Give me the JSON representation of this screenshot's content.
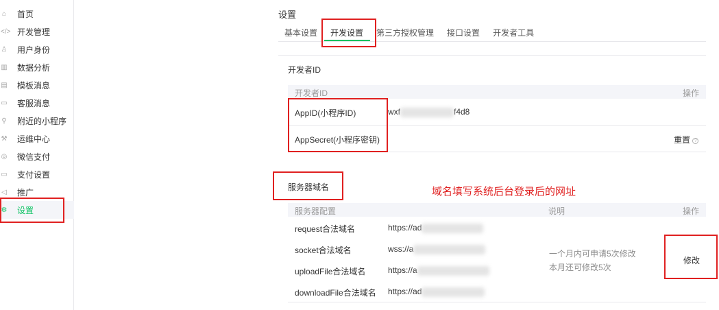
{
  "sidebar": {
    "items": [
      {
        "label": "首页",
        "icon": "home-icon",
        "glyph": "⌂"
      },
      {
        "label": "开发管理",
        "icon": "code-icon",
        "glyph": "</>"
      },
      {
        "label": "用户身份",
        "icon": "user-icon",
        "glyph": "♙"
      },
      {
        "label": "数据分析",
        "icon": "bar-chart-icon",
        "glyph": "▥"
      },
      {
        "label": "模板消息",
        "icon": "message-icon",
        "glyph": "▤"
      },
      {
        "label": "客服消息",
        "icon": "chat-icon",
        "glyph": "▭"
      },
      {
        "label": "附近的小程序",
        "icon": "location-pin-icon",
        "glyph": "⚲"
      },
      {
        "label": "运维中心",
        "icon": "wrench-icon",
        "glyph": "⚒"
      },
      {
        "label": "微信支付",
        "icon": "wechat-pay-icon",
        "glyph": "◎"
      },
      {
        "label": "支付设置",
        "icon": "card-icon",
        "glyph": "▭"
      },
      {
        "label": "推广",
        "icon": "megaphone-icon",
        "glyph": "◁"
      },
      {
        "label": "设置",
        "icon": "settings-icon",
        "glyph": "⚙"
      }
    ],
    "active_index": 11,
    "active_color": "#07c160"
  },
  "header": {
    "title": "设置",
    "tabs": [
      "基本设置",
      "开发设置",
      "第三方授权管理",
      "接口设置",
      "开发者工具"
    ],
    "active_tab": 1
  },
  "developer_id": {
    "title": "开发者ID",
    "col_id": "开发者ID",
    "col_action": "操作",
    "rows": [
      {
        "label": "AppID(小程序ID)",
        "value_prefix": "wxf",
        "value_suffix": "f4d8"
      },
      {
        "label": "AppSecret(小程序密钥)",
        "action": "重置",
        "help_icon": "question-circle-icon"
      }
    ]
  },
  "server_domain": {
    "title": "服务器域名",
    "col_config": "服务器配置",
    "col_desc": "说明",
    "col_action": "操作",
    "rows": [
      {
        "label": "request合法域名",
        "value": "https://ad"
      },
      {
        "label": "socket合法域名",
        "value": "wss://a"
      },
      {
        "label": "uploadFile合法域名",
        "value": "https://a"
      },
      {
        "label": "downloadFile合法域名",
        "value": "https://ad"
      }
    ],
    "desc_line1": "一个月内可申请5次修改",
    "desc_line2": "本月还可修改5次",
    "action": "修改"
  },
  "annotation": {
    "text": "域名填写系统后台登录后的网址",
    "color": "#e02020"
  }
}
